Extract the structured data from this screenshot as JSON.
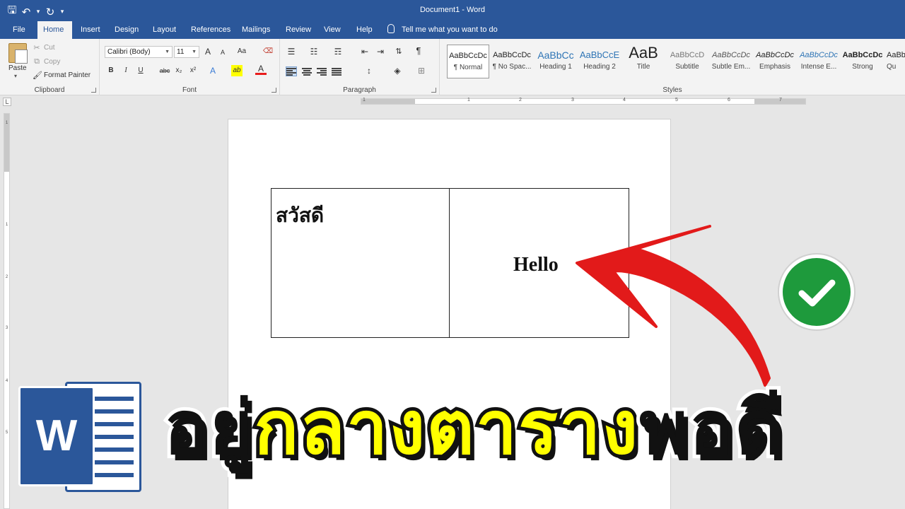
{
  "window": {
    "title": "Document1 - Word"
  },
  "quick_access": {
    "save_icon": "save-icon",
    "undo_icon": "undo-icon",
    "redo_icon": "redo-icon",
    "customize_icon": "customize-qat-icon"
  },
  "tabs": [
    {
      "label": "File"
    },
    {
      "label": "Home",
      "active": true
    },
    {
      "label": "Insert"
    },
    {
      "label": "Design"
    },
    {
      "label": "Layout"
    },
    {
      "label": "References"
    },
    {
      "label": "Mailings"
    },
    {
      "label": "Review"
    },
    {
      "label": "View"
    },
    {
      "label": "Help"
    }
  ],
  "tell_me": "Tell me what you want to do",
  "clipboard": {
    "paste": "Paste",
    "cut": "Cut",
    "copy": "Copy",
    "format_painter": "Format Painter",
    "group": "Clipboard"
  },
  "font": {
    "name": "Calibri (Body)",
    "size": "11",
    "group": "Font",
    "bold": "B",
    "italic": "I",
    "underline": "U",
    "strike": "abc",
    "sub": "x₂",
    "sup": "x²",
    "grow": "A",
    "shrink": "A",
    "case": "Aa",
    "effects": "A",
    "highlight": "ab",
    "color": "A"
  },
  "paragraph": {
    "group": "Paragraph",
    "show_marks": "¶"
  },
  "styles": {
    "group": "Styles",
    "items": [
      {
        "sample": "AaBbCcDc",
        "name": "¶ Normal",
        "selected": true
      },
      {
        "sample": "AaBbCcDc",
        "name": "¶ No Spac..."
      },
      {
        "sample": "AaBbCc",
        "name": "Heading 1"
      },
      {
        "sample": "AaBbCcE",
        "name": "Heading 2"
      },
      {
        "sample": "AaB",
        "name": "Title"
      },
      {
        "sample": "AaBbCcD",
        "name": "Subtitle"
      },
      {
        "sample": "AaBbCcDc",
        "name": "Subtle Em..."
      },
      {
        "sample": "AaBbCcDc",
        "name": "Emphasis"
      },
      {
        "sample": "AaBbCcDc",
        "name": "Intense E..."
      },
      {
        "sample": "AaBbCcDc",
        "name": "Strong"
      },
      {
        "sample": "AaBbCcDc",
        "name": "Qu"
      }
    ]
  },
  "ruler": {
    "corner": "L",
    "h_numbers": [
      "1",
      "1",
      "2",
      "3",
      "4",
      "5",
      "6",
      "7"
    ],
    "v_numbers": [
      "1",
      "1",
      "2",
      "3",
      "4",
      "5"
    ]
  },
  "document": {
    "table": [
      {
        "text": "สวัสดี"
      },
      {
        "text": "Hello"
      }
    ]
  },
  "overlay": {
    "caption_black_start": "อยู่",
    "caption_yellow": "กลางตาราง",
    "caption_black_end": "พอดี",
    "logo_letter": "W",
    "arrow_color": "#e21a1a",
    "check_color": "#1e9a3c"
  },
  "colors": {
    "word_blue": "#2b579a",
    "ribbon": "#f3f3f3"
  }
}
